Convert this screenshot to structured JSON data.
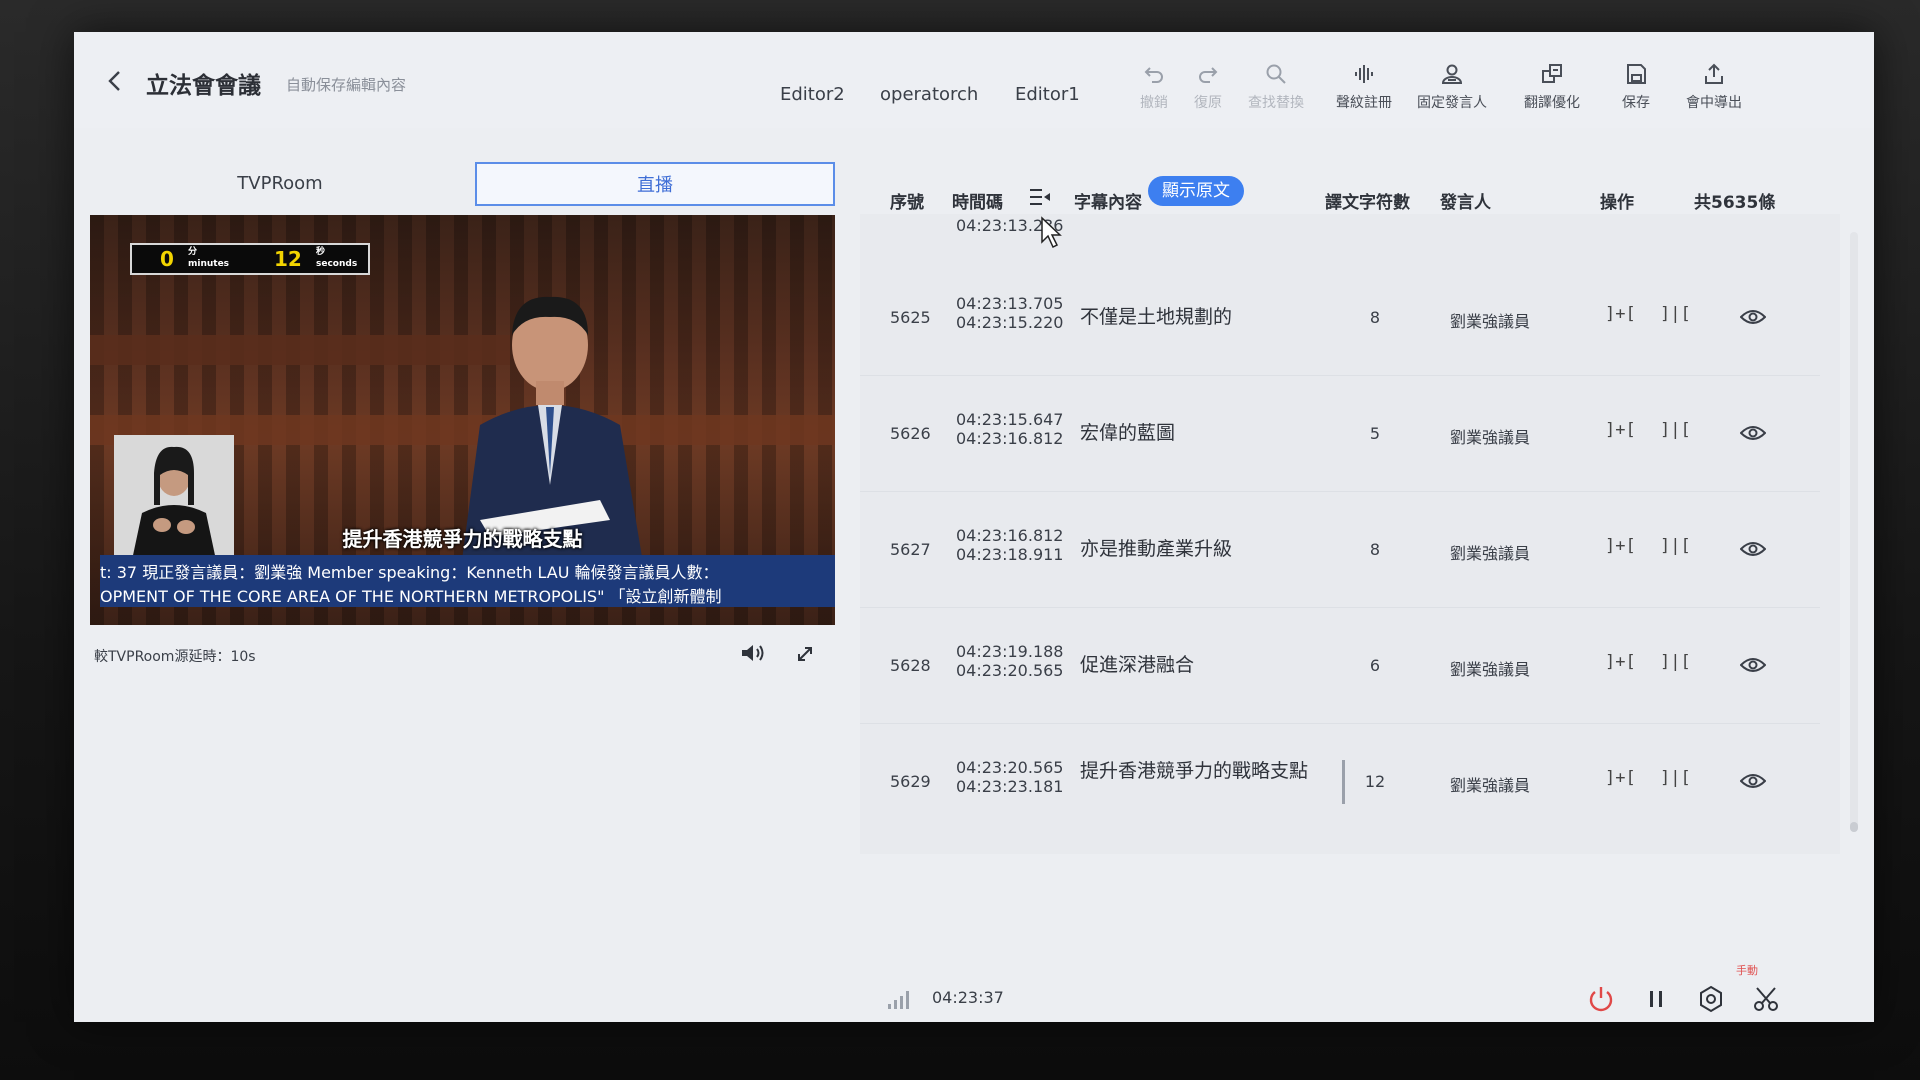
{
  "header": {
    "title": "立法會會議",
    "autosave": "自動保存編輯內容",
    "editors": [
      "Editor2",
      "operatorch",
      "Editor1"
    ],
    "tools": [
      {
        "label": "撤銷",
        "icon": "undo-icon",
        "disabled": true
      },
      {
        "label": "復原",
        "icon": "redo-icon",
        "disabled": true
      },
      {
        "label": "查找替換",
        "icon": "search-icon",
        "disabled": true
      },
      {
        "label": "聲紋註冊",
        "icon": "voiceprint-icon",
        "disabled": false
      },
      {
        "label": "固定發言人",
        "icon": "fixed-speaker-icon",
        "disabled": false
      },
      {
        "label": "翻譯優化",
        "icon": "translate-icon",
        "disabled": false
      },
      {
        "label": "保存",
        "icon": "save-icon",
        "disabled": false
      },
      {
        "label": "會中導出",
        "icon": "export-icon",
        "disabled": false
      }
    ]
  },
  "left": {
    "tabs": [
      "TVPRoom",
      "直播"
    ],
    "active_tab": 1,
    "video": {
      "timer_minutes": "0",
      "timer_min_cn": "分",
      "timer_min_en": "minutes",
      "timer_seconds": "12",
      "timer_sec_cn": "秒",
      "timer_sec_en": "seconds",
      "subtitle": "提升香港競爭力的戰略支點",
      "ticker_line1": "t: 37   現正發言議員：劉業強    Member speaking：Kenneth LAU    輪候發言議員人數：",
      "ticker_line2": "OPMENT OF THE CORE AREA OF THE NORTHERN METROPOLIS\"  「設立創新體制"
    },
    "delay_text": "較TVPRoom源延時：10s"
  },
  "table": {
    "columns": {
      "index": "序號",
      "timecode": "時間碼",
      "content": "字幕內容",
      "toggle": "顯示原文",
      "char_count": "譯文字符數",
      "speaker": "發言人",
      "ops": "操作",
      "total": "共5635條"
    },
    "partial_timecode": "04:23:13.236",
    "op_merge": "]+[",
    "op_split": "]|[",
    "rows": [
      {
        "index": "5625",
        "start": "04:23:13.705",
        "end": "04:23:15.220",
        "text": "不僅是土地規劃的",
        "count": "8",
        "speaker": "劉業強議員"
      },
      {
        "index": "5626",
        "start": "04:23:15.647",
        "end": "04:23:16.812",
        "text": "宏偉的藍圖",
        "count": "5",
        "speaker": "劉業強議員"
      },
      {
        "index": "5627",
        "start": "04:23:16.812",
        "end": "04:23:18.911",
        "text": "亦是推動產業升級",
        "count": "8",
        "speaker": "劉業強議員"
      },
      {
        "index": "5628",
        "start": "04:23:19.188",
        "end": "04:23:20.565",
        "text": "促進深港融合",
        "count": "6",
        "speaker": "劉業強議員"
      },
      {
        "index": "5629",
        "start": "04:23:20.565",
        "end": "04:23:23.181",
        "text": "提升香港競爭力的戰略支點",
        "count": "12",
        "speaker": "劉業強議員"
      }
    ]
  },
  "footer": {
    "clock": "04:23:37",
    "manual_badge": "手動"
  },
  "colors": {
    "accent": "#3d7ff0",
    "power": "#e04848",
    "background": "#eceef2"
  }
}
